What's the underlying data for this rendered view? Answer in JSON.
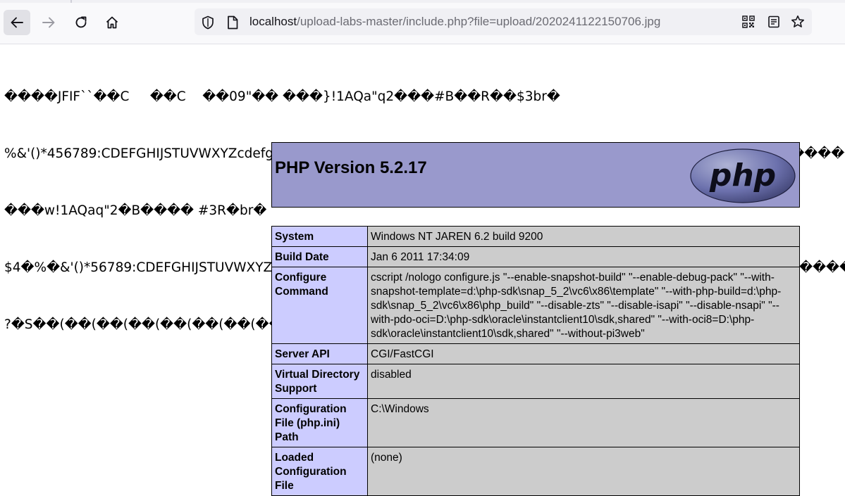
{
  "browser": {
    "url_host": "localhost",
    "url_path": "/upload-labs-master/include.php?file=upload/2020241122150706.jpg",
    "icons": [
      "back-arrow-icon",
      "forward-arrow-icon",
      "reload-icon",
      "home-icon",
      "shield-icon",
      "page-icon",
      "qr-code-icon",
      "reader-view-icon",
      "bookmark-star-icon"
    ]
  },
  "garbled_lines": [
    "����JFIF``��C     ��C    ��09\"�� ���}!1AQa\"q2���#B��R��$3br�",
    "%&'()*456789:CDEFGHIJSTUVWXYZcdefghijstuvwxyz��������������������������������������������",
    "���w!1AQaq\"2�B���� #3R�br�",
    "$4�%�&'()*56789:CDEFGHIJSTUVWXYZcdefghijstuvwxyz�������������������������������������",
    "?�S��(��(��(��(��(��(��(��(��(��(��"
  ],
  "phpinfo": {
    "title": "PHP Version 5.2.17",
    "logo_text": "php",
    "colors": {
      "header_bg": "#9999cc",
      "label_bg": "#ccccff",
      "value_bg": "#cccccc"
    },
    "rows": [
      {
        "label": "System",
        "value": "Windows NT JAREN 6.2 build 9200"
      },
      {
        "label": "Build Date",
        "value": "Jan 6 2011 17:34:09"
      },
      {
        "label": "Configure Command",
        "value": "cscript /nologo configure.js \"--enable-snapshot-build\" \"--enable-debug-pack\" \"--with-snapshot-template=d:\\php-sdk\\snap_5_2\\vc6\\x86\\template\" \"--with-php-build=d:\\php-sdk\\snap_5_2\\vc6\\x86\\php_build\" \"--disable-zts\" \"--disable-isapi\" \"--disable-nsapi\" \"--with-pdo-oci=D:\\php-sdk\\oracle\\instantclient10\\sdk,shared\" \"--with-oci8=D:\\php-sdk\\oracle\\instantclient10\\sdk,shared\" \"--without-pi3web\""
      },
      {
        "label": "Server API",
        "value": "CGI/FastCGI"
      },
      {
        "label": "Virtual Directory Support",
        "value": "disabled"
      },
      {
        "label": "Configuration File (php.ini) Path",
        "value": "C:\\Windows"
      },
      {
        "label": "Loaded Configuration File",
        "value": "(none)"
      }
    ]
  }
}
